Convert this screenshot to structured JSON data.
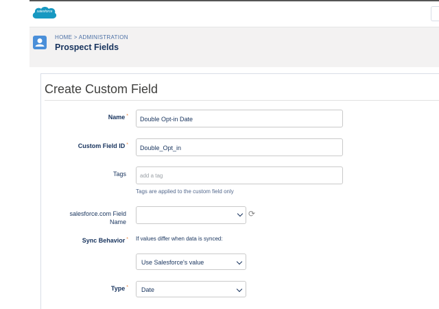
{
  "brand": {
    "logo_text": "salesforce"
  },
  "header": {
    "breadcrumb": "HOME > ADMINISTRATION",
    "title": "Prospect Fields"
  },
  "form": {
    "title": "Create Custom Field",
    "name": {
      "label": "Name",
      "value": "Double Opt-in Date"
    },
    "custom_field_id": {
      "label": "Custom Field ID",
      "value": "Double_Opt_in"
    },
    "tags": {
      "label": "Tags",
      "placeholder": "add a tag",
      "help": "Tags are applied to the custom field only"
    },
    "sf_field": {
      "label_line1": "salesforce.com Field",
      "label_line2": "Name",
      "value": ""
    },
    "sync_behavior": {
      "label": "Sync Behavior",
      "help": "If values differ when data is synced:",
      "value": "Use Salesforce's value"
    },
    "type": {
      "label": "Type",
      "value": "Date"
    }
  },
  "icons": {
    "refresh": "refresh-icon",
    "user": "contact-icon"
  },
  "colors": {
    "accent": "#4a8fd9",
    "required": "#e8803a"
  }
}
